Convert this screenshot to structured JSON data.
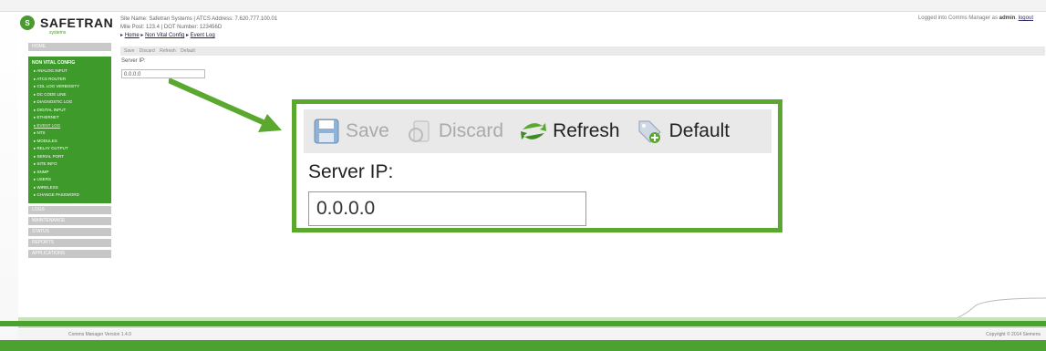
{
  "header": {
    "logo_text": "SAFETRAN",
    "logo_sub": "systems",
    "site_name_line": "Site Name: Safetran Systems  |  ATCS Address: 7.620.777.100.01",
    "mile_post_line": "Mile Post: 123.4            |  DOT Number: 123456D",
    "breadcrumb": [
      "Home",
      "Non Vital Config",
      "Event Log"
    ],
    "login_prefix": "Logged into Comms Manager as",
    "login_user": "admin",
    "logout": "logout"
  },
  "sidebar": {
    "home": "HOME",
    "section_title": "NON VITAL CONFIG",
    "items": [
      "ANALOG INPUT",
      "ATCS ROUTER",
      "CDL LOG VERBOSITY",
      "DC CODE LINE",
      "DIAGNOSTIC LOG",
      "DIGITAL INPUT",
      "ETHERNET",
      "EVENT LOG",
      "NTS",
      "MODULES",
      "RELAY OUTPUT",
      "SERIAL PORT",
      "SITE INFO",
      "SNMP",
      "USERS",
      "WIRELESS",
      "CHANGE PASSWORD"
    ],
    "active_index": 7,
    "bottom_sections": [
      "LOGS",
      "MAINTENANCE",
      "STATUS",
      "REPORTS",
      "APPLICATIONS"
    ]
  },
  "mini": {
    "toolbar": [
      "Save",
      "Discard",
      "Refresh",
      "Default"
    ],
    "label": "Server IP:",
    "value": "0.0.0.0"
  },
  "zoom": {
    "toolbar": {
      "save": "Save",
      "discard": "Discard",
      "refresh": "Refresh",
      "default": "Default"
    },
    "label": "Server IP:",
    "value": "0.0.0.0"
  },
  "footer": {
    "version": "Comms Manager Version 1.4.0",
    "copyright": "Copyright © 2014 Siemens"
  },
  "colors": {
    "accent_green": "#5aa82d",
    "sidebar_green": "#3f9a2c"
  }
}
